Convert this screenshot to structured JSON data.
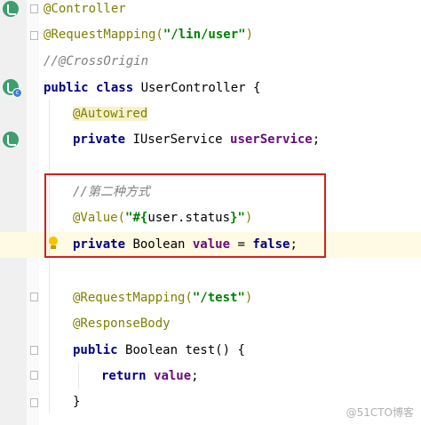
{
  "editor": {
    "lines": [
      [
        {
          "t": "@Controller",
          "c": "ann"
        }
      ],
      [
        {
          "t": "@RequestMapping(",
          "c": "ann"
        },
        {
          "t": "\"/lin/user\"",
          "c": "str"
        },
        {
          "t": ")",
          "c": "ann"
        }
      ],
      [
        {
          "t": "//@CrossOrigin",
          "c": "cmt"
        }
      ],
      [
        {
          "t": "public class ",
          "c": "kw"
        },
        {
          "t": "UserController {",
          "c": "plain"
        }
      ],
      [
        {
          "t": "@Autowired",
          "c": "ann-bg"
        }
      ],
      [
        {
          "t": "private ",
          "c": "kw"
        },
        {
          "t": "IUserService ",
          "c": "plain"
        },
        {
          "t": "userService",
          "c": "field"
        },
        {
          "t": ";",
          "c": "plain"
        }
      ],
      [],
      [
        {
          "t": "//第二种方式",
          "c": "cmt"
        }
      ],
      [
        {
          "t": "@Value(",
          "c": "ann"
        },
        {
          "t": "\"#{",
          "c": "str"
        },
        {
          "t": "user.status",
          "c": "plain"
        },
        {
          "t": "}\"",
          "c": "str"
        },
        {
          "t": ")",
          "c": "ann"
        }
      ],
      [
        {
          "t": "private ",
          "c": "kw"
        },
        {
          "t": "Boolean ",
          "c": "plain"
        },
        {
          "t": "value",
          "c": "field"
        },
        {
          "t": " = ",
          "c": "plain"
        },
        {
          "t": "false",
          "c": "kw"
        },
        {
          "t": ";",
          "c": "plain"
        }
      ],
      [],
      [
        {
          "t": "@RequestMapping(",
          "c": "ann"
        },
        {
          "t": "\"/test\"",
          "c": "str"
        },
        {
          "t": ")",
          "c": "ann"
        }
      ],
      [
        {
          "t": "@ResponseBody",
          "c": "ann"
        }
      ],
      [
        {
          "t": "public ",
          "c": "kw"
        },
        {
          "t": "Boolean ",
          "c": "plain"
        },
        {
          "t": "test() {",
          "c": "plain"
        }
      ],
      [
        {
          "t": "return ",
          "c": "kw"
        },
        {
          "t": "value",
          "c": "field"
        },
        {
          "t": ";",
          "c": "plain"
        }
      ],
      [
        {
          "t": "}",
          "c": "plain"
        }
      ]
    ]
  },
  "gutter_icons": [
    "spring-bean-icon",
    "spring-bean-class-icon",
    "spring-autowired-icon",
    "intention-bulb-icon"
  ],
  "watermark": "@51CTO博客",
  "colors": {
    "highlight_box": "#d3201f",
    "current_line": "#fffae3"
  }
}
